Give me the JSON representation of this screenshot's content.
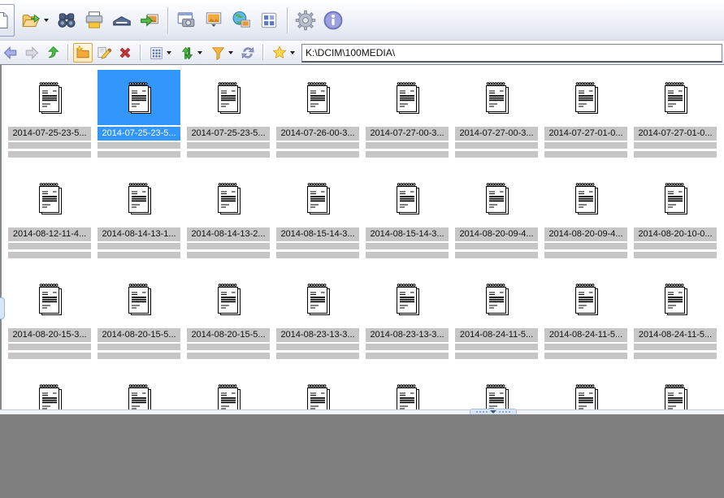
{
  "colors": {
    "selection_blue": "#3296fa",
    "label_gray": "#c6c6c6",
    "preview_gray": "#7f7f7f",
    "toolbar_gradient_top": "#ffffff",
    "toolbar_gradient_bottom": "#dde2ee"
  },
  "toolbar_main": {
    "icons": [
      "new-file-icon",
      "open-folder-icon",
      "find-icon",
      "print-icon",
      "scan-icon",
      "convert-export-icon",
      "screen-capture-icon",
      "slideshow-icon",
      "web-globe-icon",
      "contact-sheet-icon",
      "settings-gear-icon",
      "info-icon"
    ]
  },
  "toolbar_nav": {
    "icons": [
      "back-icon",
      "forward-icon",
      "up-icon",
      "new-folder-icon",
      "rename-icon",
      "delete-icon",
      "view-mode-icon",
      "sort-icon",
      "filter-icon",
      "refresh-icon",
      "favorites-star-icon"
    ],
    "address_value": "K:\\DCIM\\100MEDIA\\"
  },
  "file_grid": {
    "columns": 8,
    "selected_index": 1,
    "file_icon": "notepad-file-icon",
    "items": [
      "2014-07-25-23-5...",
      "2014-07-25-23-5...",
      "2014-07-25-23-5...",
      "2014-07-26-00-3...",
      "2014-07-27-00-3...",
      "2014-07-27-00-3...",
      "2014-07-27-01-0...",
      "2014-07-27-01-0...",
      "2014-08-12-11-4...",
      "2014-08-14-13-1...",
      "2014-08-14-13-2...",
      "2014-08-15-14-3...",
      "2014-08-15-14-3...",
      "2014-08-20-09-4...",
      "2014-08-20-09-4...",
      "2014-08-20-10-0...",
      "2014-08-20-15-3...",
      "2014-08-20-15-5...",
      "2014-08-20-15-5...",
      "2014-08-23-13-3...",
      "2014-08-23-13-3...",
      "2014-08-24-11-5...",
      "2014-08-24-11-5...",
      "2014-08-24-11-5..."
    ],
    "partial_next_row_icons": 8
  },
  "splitter": {
    "bottom_handle": "collapse-down",
    "left_handle": "collapse-left"
  }
}
